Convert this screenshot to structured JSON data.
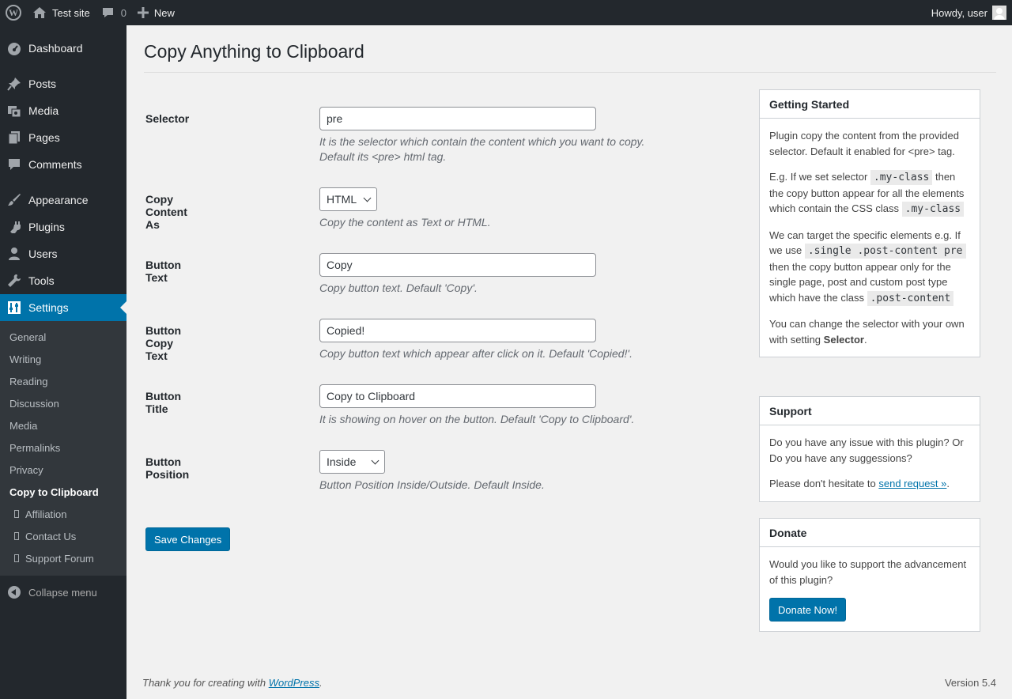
{
  "adminbar": {
    "site_name": "Test site",
    "comments_count": "0",
    "new_label": "New",
    "howdy": "Howdy, user"
  },
  "sidebar": {
    "items": [
      {
        "label": "Dashboard",
        "icon": "dashboard-icon"
      },
      {
        "label": "Posts",
        "icon": "pin-icon"
      },
      {
        "label": "Media",
        "icon": "media-icon"
      },
      {
        "label": "Pages",
        "icon": "pages-icon"
      },
      {
        "label": "Comments",
        "icon": "comment-icon"
      },
      {
        "label": "Appearance",
        "icon": "brush-icon"
      },
      {
        "label": "Plugins",
        "icon": "plug-icon"
      },
      {
        "label": "Users",
        "icon": "user-icon"
      },
      {
        "label": "Tools",
        "icon": "wrench-icon"
      },
      {
        "label": "Settings",
        "icon": "settings-icon"
      }
    ],
    "submenu": [
      "General",
      "Writing",
      "Reading",
      "Discussion",
      "Media",
      "Permalinks",
      "Privacy",
      "Copy to Clipboard",
      "Affiliation",
      "Contact Us",
      "Support Forum"
    ],
    "collapse": "Collapse menu"
  },
  "page": {
    "title": "Copy Anything to Clipboard",
    "fields": {
      "selector": {
        "label": "Selector",
        "value": "pre",
        "desc": "It is the selector which contain the content which you want to copy. Default its <pre> html tag."
      },
      "copy_as": {
        "label": "Copy Content As",
        "value": "HTML",
        "desc": "Copy the content as Text or HTML."
      },
      "button_text": {
        "label": "Button Text",
        "value": "Copy",
        "desc": "Copy button text. Default 'Copy'."
      },
      "button_copy_text": {
        "label": "Button Copy Text",
        "value": "Copied!",
        "desc": "Copy button text which appear after click on it. Default 'Copied!'."
      },
      "button_title": {
        "label": "Button Title",
        "value": "Copy to Clipboard",
        "desc": "It is showing on hover on the button. Default 'Copy to Clipboard'."
      },
      "button_position": {
        "label": "Button Position",
        "value": "Inside",
        "desc": "Button Position Inside/Outside. Default Inside."
      }
    },
    "save_label": "Save Changes"
  },
  "boxes": {
    "getting_started": {
      "title": "Getting Started",
      "p1": "Plugin copy the content from the provided selector. Default it enabled for <pre> tag.",
      "p2_a": "E.g. If we set selector",
      "p2_code1": ".my-class",
      "p2_b": "then the copy button appear for all the elements which contain the CSS class",
      "p2_code2": ".my-class",
      "p3_a": "We can target the specific elements e.g. If we use",
      "p3_code1": ".single .post-content pre",
      "p3_b": "then the copy button appear only for the single page, post and custom post type which have the class",
      "p3_code2": ".post-content",
      "p4_a": "You can change the selector with your own with setting",
      "p4_strong": "Selector",
      "p4_b": "."
    },
    "support": {
      "title": "Support",
      "p1": "Do you have any issue with this plugin? Or Do you have any suggessions?",
      "p2_a": "Please don't hesitate to",
      "p2_link": "send request »",
      "p2_b": "."
    },
    "donate": {
      "title": "Donate",
      "p1": "Would you like to support the advancement of this plugin?",
      "button": "Donate Now!"
    }
  },
  "footer": {
    "thanks_a": "Thank you for creating with",
    "thanks_link": "WordPress",
    "thanks_b": ".",
    "version": "Version 5.4"
  }
}
